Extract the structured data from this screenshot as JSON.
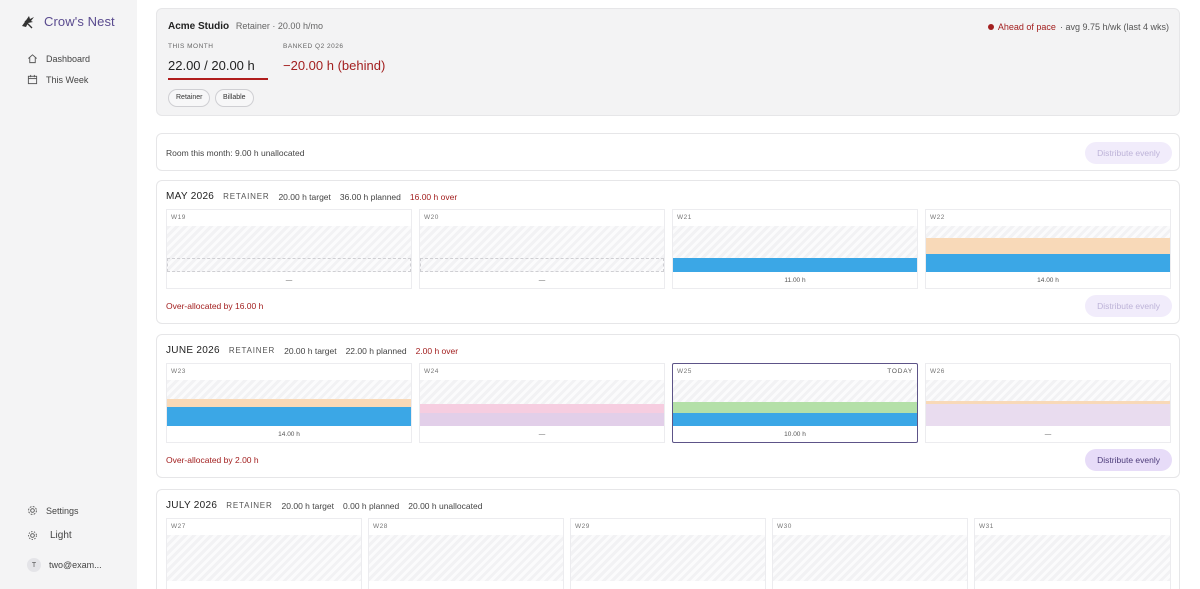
{
  "app": {
    "name": "Crow's Nest"
  },
  "sidebar": {
    "nav": [
      {
        "label": "Dashboard",
        "icon": "home-icon"
      },
      {
        "label": "This Week",
        "icon": "calendar-icon"
      }
    ],
    "settings_label": "Settings",
    "theme_label": "Light",
    "user_email": "two@exam...",
    "user_initial": "T"
  },
  "header": {
    "client": "Acme Studio",
    "plan": "Retainer · 20.00 h/mo",
    "pace_status": "Ahead of pace",
    "pace_detail": " · avg 9.75 h/wk (last 4 wks)",
    "this_month_label": "THIS MONTH",
    "this_month_value": "22.00 / 20.00 h",
    "banked_label": "BANKED Q2 2026",
    "banked_value": "−20.00 h (behind)",
    "tags": [
      "Retainer",
      "Billable"
    ]
  },
  "room": {
    "text": "Room this month: 9.00 h unallocated",
    "button": "Distribute evenly"
  },
  "months": [
    {
      "name": "MAY 2026",
      "kind": "RETAINER",
      "target": "20.00 h target",
      "planned": "36.00 h planned",
      "status": "16.00 h over",
      "weeks": [
        {
          "label": "W19",
          "value": "—"
        },
        {
          "label": "W20",
          "value": "—"
        },
        {
          "label": "W21",
          "value": "11.00 h"
        },
        {
          "label": "W22",
          "value": "14.00 h"
        }
      ],
      "footer": "Over-allocated by 16.00 h",
      "button": "Distribute evenly"
    },
    {
      "name": "JUNE 2026",
      "kind": "RETAINER",
      "target": "20.00 h target",
      "planned": "22.00 h planned",
      "status": "2.00 h over",
      "weeks": [
        {
          "label": "W23",
          "value": "14.00 h"
        },
        {
          "label": "W24",
          "value": "—"
        },
        {
          "label": "W25",
          "value": "10.00 h",
          "today": "TODAY"
        },
        {
          "label": "W26",
          "value": "—"
        }
      ],
      "footer": "Over-allocated by 2.00 h",
      "button": "Distribute evenly"
    },
    {
      "name": "JULY 2026",
      "kind": "RETAINER",
      "target": "20.00 h target",
      "planned": "0.00 h planned",
      "status": "20.00 h unallocated",
      "weeks": [
        {
          "label": "W27"
        },
        {
          "label": "W28"
        },
        {
          "label": "W29"
        },
        {
          "label": "W30"
        },
        {
          "label": "W31"
        }
      ]
    }
  ],
  "colors": {
    "brand": "#5a4b8f",
    "alert": "#a32020",
    "blue": "#3ba7e6",
    "peach": "#f8d9b8",
    "pink": "#f6cde0",
    "lavender": "#e2cfe9",
    "green": "#b4e0a8"
  }
}
